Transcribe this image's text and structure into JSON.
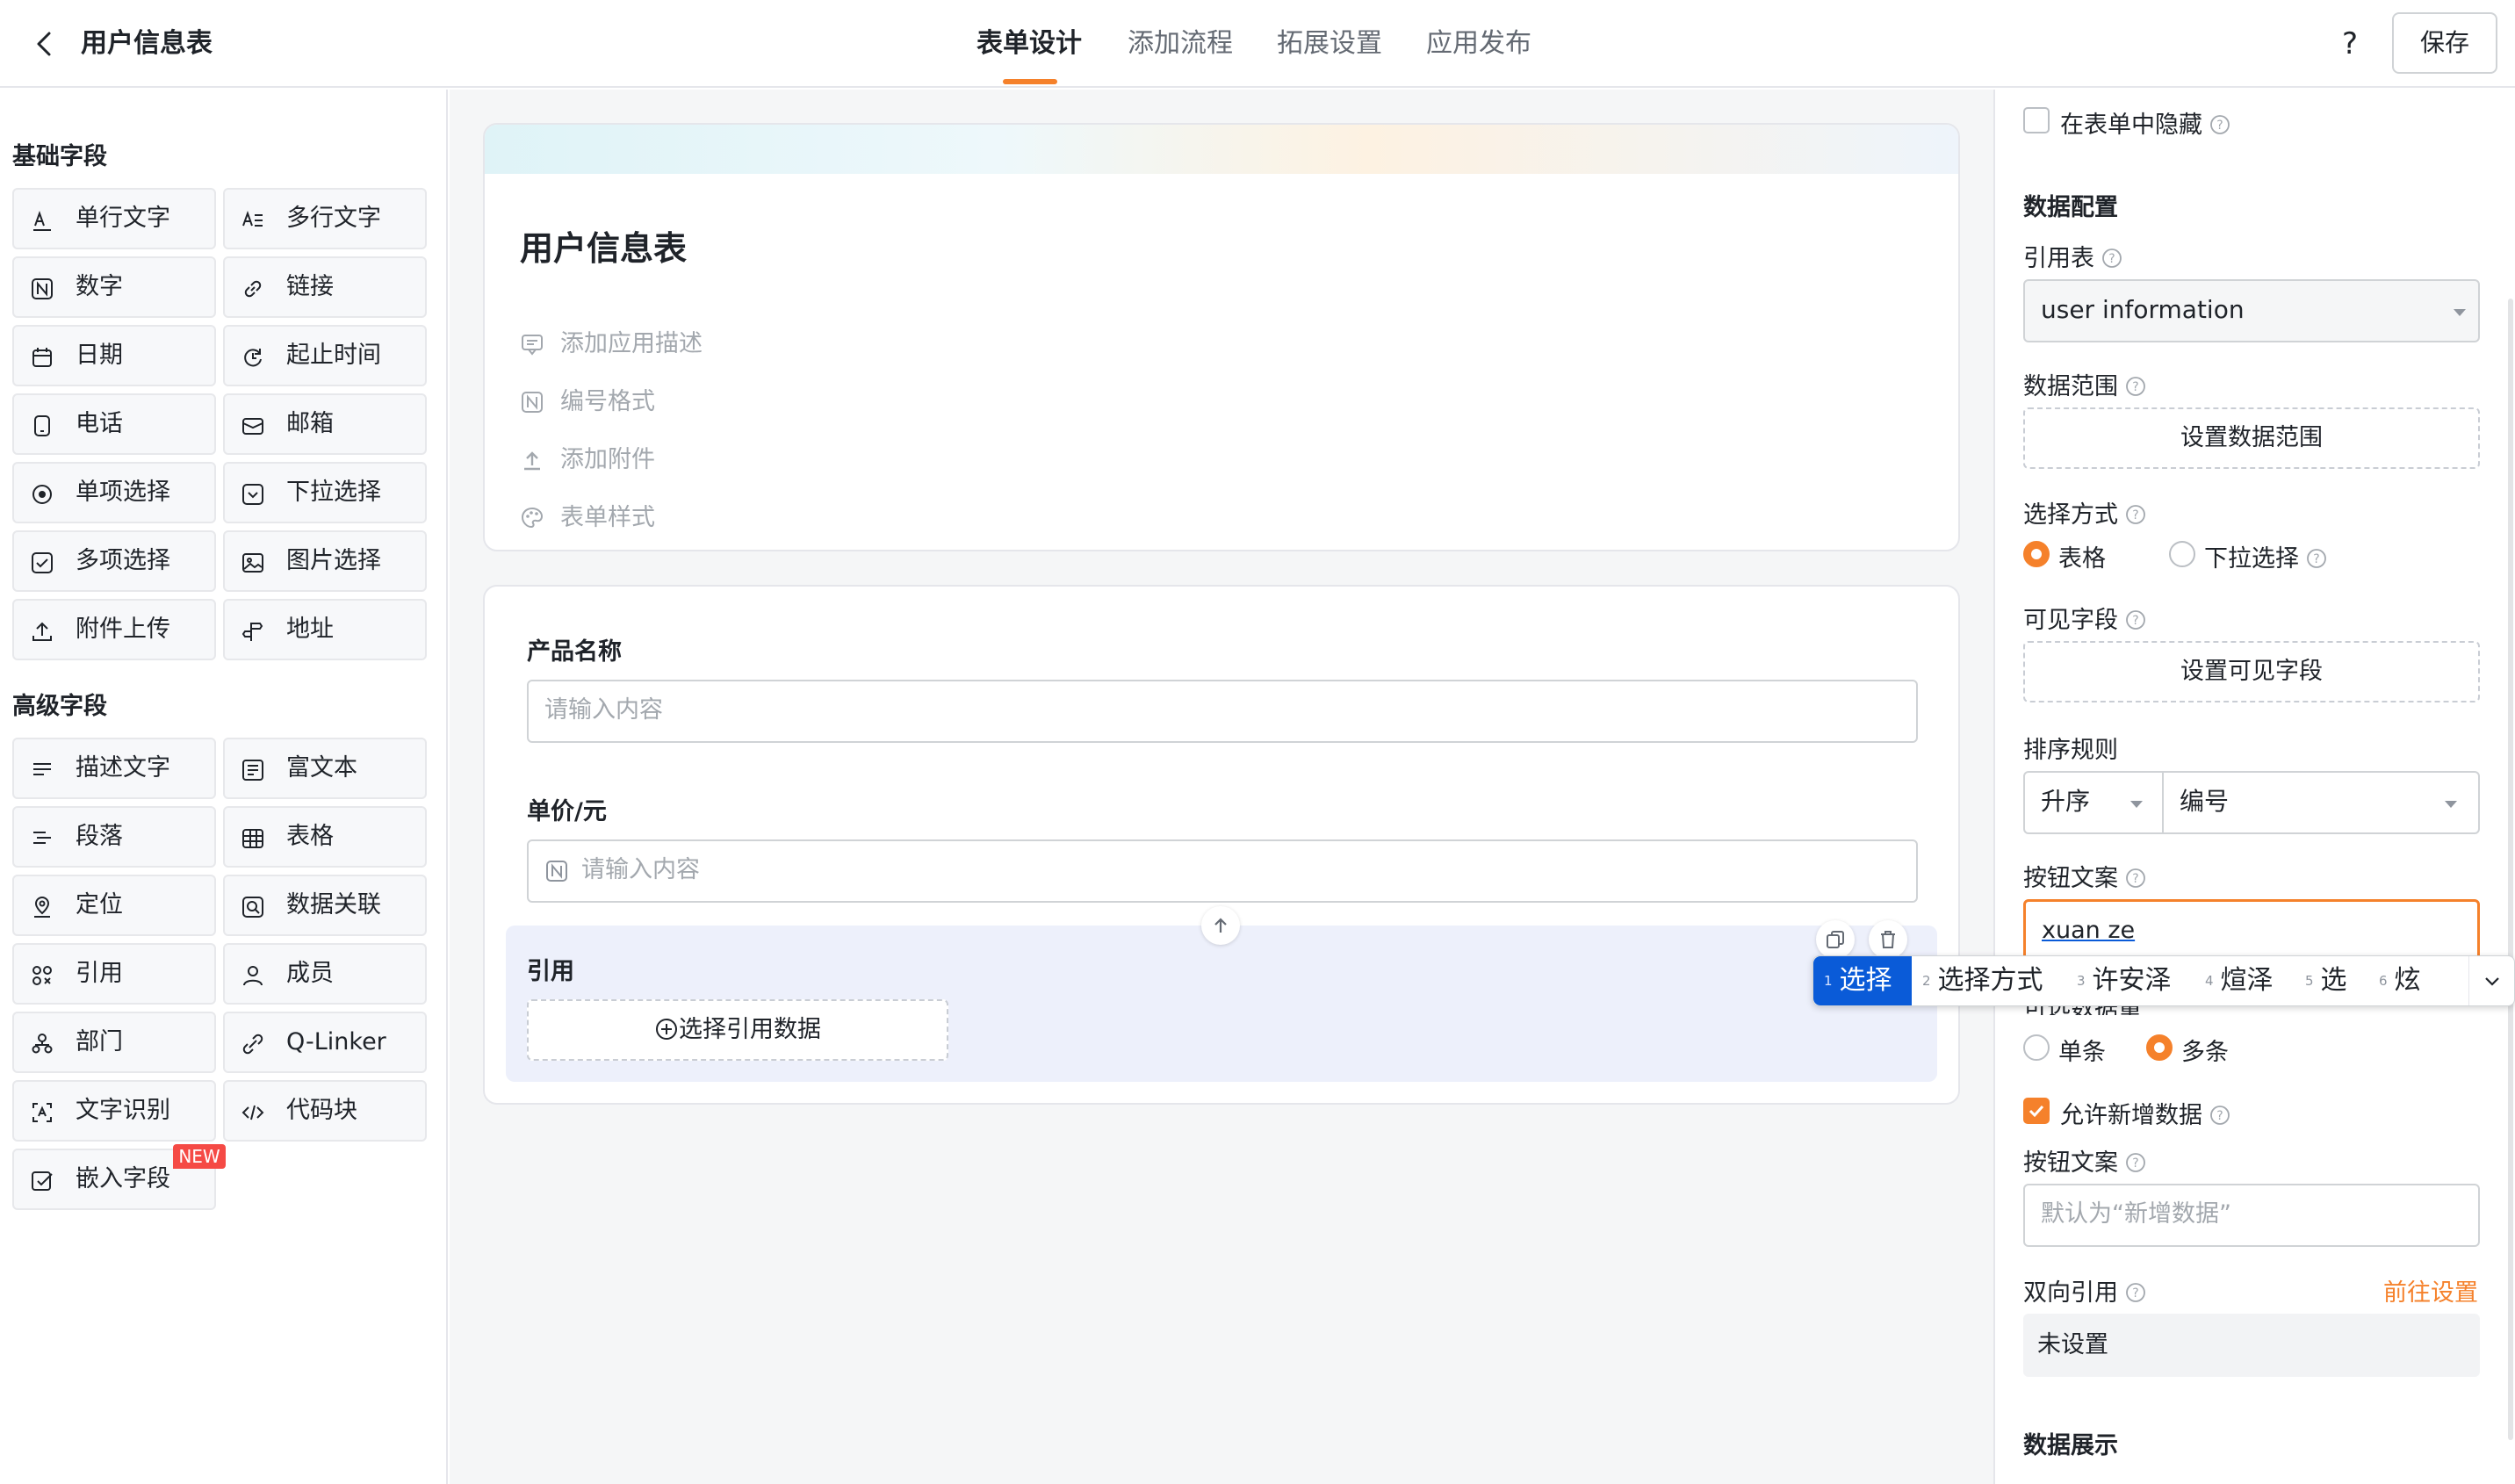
{
  "header": {
    "app_title": "用户信息表",
    "tabs": [
      {
        "label": "表单设计",
        "active": true
      },
      {
        "label": "添加流程",
        "active": false
      },
      {
        "label": "拓展设置",
        "active": false
      },
      {
        "label": "应用发布",
        "active": false
      }
    ],
    "help_label": "?",
    "save_label": "保存",
    "accent_color": "#f5812b"
  },
  "left_panel": {
    "basic_title": "基础字段",
    "basic_fields": [
      {
        "label": "单行文字",
        "icon": "single-line-text-icon"
      },
      {
        "label": "多行文字",
        "icon": "multi-line-text-icon"
      },
      {
        "label": "数字",
        "icon": "number-icon"
      },
      {
        "label": "链接",
        "icon": "link-icon"
      },
      {
        "label": "日期",
        "icon": "calendar-icon"
      },
      {
        "label": "起止时间",
        "icon": "time-range-icon"
      },
      {
        "label": "电话",
        "icon": "phone-icon"
      },
      {
        "label": "邮箱",
        "icon": "mail-icon"
      },
      {
        "label": "单项选择",
        "icon": "radio-icon"
      },
      {
        "label": "下拉选择",
        "icon": "dropdown-icon"
      },
      {
        "label": "多项选择",
        "icon": "checkbox-icon"
      },
      {
        "label": "图片选择",
        "icon": "image-icon"
      },
      {
        "label": "附件上传",
        "icon": "upload-icon"
      },
      {
        "label": "地址",
        "icon": "address-icon"
      }
    ],
    "advanced_title": "高级字段",
    "advanced_fields": [
      {
        "label": "描述文字",
        "icon": "description-icon"
      },
      {
        "label": "富文本",
        "icon": "rich-text-icon"
      },
      {
        "label": "段落",
        "icon": "paragraph-icon"
      },
      {
        "label": "表格",
        "icon": "table-icon"
      },
      {
        "label": "定位",
        "icon": "location-icon"
      },
      {
        "label": "数据关联",
        "icon": "data-link-icon"
      },
      {
        "label": "引用",
        "icon": "reference-icon"
      },
      {
        "label": "成员",
        "icon": "member-icon"
      },
      {
        "label": "部门",
        "icon": "department-icon"
      },
      {
        "label": "Q-Linker",
        "icon": "q-linker-icon"
      },
      {
        "label": "文字识别",
        "icon": "ocr-icon"
      },
      {
        "label": "代码块",
        "icon": "code-icon"
      },
      {
        "label": "嵌入字段",
        "icon": "embed-icon"
      }
    ],
    "new_badge": "NEW"
  },
  "canvas": {
    "form_title": "用户信息表",
    "meta_rows": [
      {
        "label": "添加应用描述",
        "icon": "comment-icon"
      },
      {
        "label": "编号格式",
        "icon": "number-format-icon"
      },
      {
        "label": "添加附件",
        "icon": "attachment-upload-icon"
      },
      {
        "label": "表单样式",
        "icon": "palette-icon"
      }
    ],
    "fields": {
      "product_name_label": "产品名称",
      "product_name_placeholder": "请输入内容",
      "unit_price_label": "单价/元",
      "unit_price_placeholder": "请输入内容",
      "reference_label": "引用",
      "reference_button": "选择引用数据"
    }
  },
  "right_panel": {
    "hide_in_form_label": "在表单中隐藏",
    "data_config_title": "数据配置",
    "ref_table_label": "引用表",
    "ref_table_value": "user information",
    "data_range_label": "数据范围",
    "data_range_button": "设置数据范围",
    "select_mode_label": "选择方式",
    "select_mode_options": [
      {
        "label": "表格",
        "checked": true
      },
      {
        "label": "下拉选择",
        "checked": false
      }
    ],
    "visible_fields_label": "可见字段",
    "visible_fields_button": "设置可见字段",
    "sort_rule_label": "排序规则",
    "sort_order_value": "升序",
    "sort_field_value": "编号",
    "button_text_label": "按钮文案",
    "button_text_value": "xuan ze",
    "selectable_count_label": "可选数据量",
    "count_options": [
      {
        "label": "单条",
        "checked": false
      },
      {
        "label": "多条",
        "checked": true
      }
    ],
    "allow_new_label": "允许新增数据",
    "allow_new_checked": true,
    "button_text2_label": "按钮文案",
    "button_text2_placeholder": "默认为“新增数据”",
    "bidirectional_label": "双向引用",
    "bidirectional_link": "前往设置",
    "bidirectional_value": "未设置",
    "data_display_title": "数据展示"
  },
  "ime": {
    "candidates": [
      {
        "num": "1",
        "text": "选择"
      },
      {
        "num": "2",
        "text": "选择方式"
      },
      {
        "num": "3",
        "text": "许安泽"
      },
      {
        "num": "4",
        "text": "煊泽"
      },
      {
        "num": "5",
        "text": "选"
      },
      {
        "num": "6",
        "text": "炫"
      }
    ],
    "selected_color": "#0a5bd8"
  }
}
